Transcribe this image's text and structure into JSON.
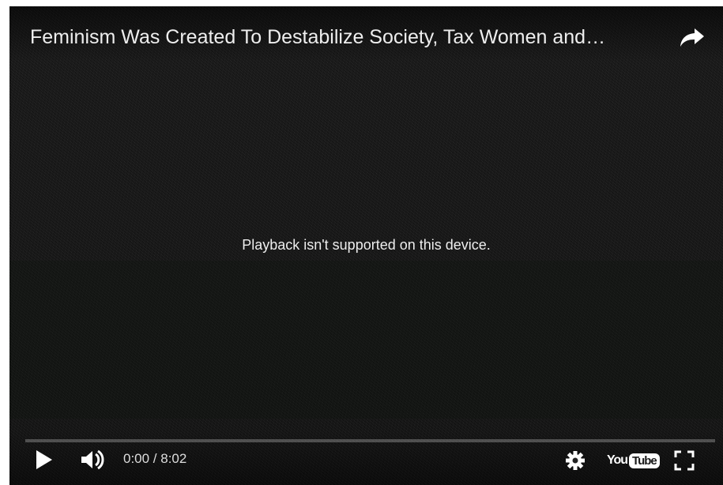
{
  "video": {
    "title": "Feminism Was Created To Destabilize Society, Tax Women and…",
    "message": "Playback isn't supported on this device."
  },
  "controls": {
    "time": "0:00 / 8:02",
    "progress_percent": 0,
    "logo_you": "You",
    "logo_tube": "Tube"
  },
  "icons": {
    "share": "share-arrow-icon",
    "play": "play-icon",
    "volume": "volume-icon",
    "settings": "gear-icon",
    "fullscreen": "fullscreen-icon"
  },
  "colors": {
    "background": "#1a1a1a",
    "text": "#eeeeee",
    "progress_track": "#555555",
    "progress_fill": "#cc181e"
  }
}
